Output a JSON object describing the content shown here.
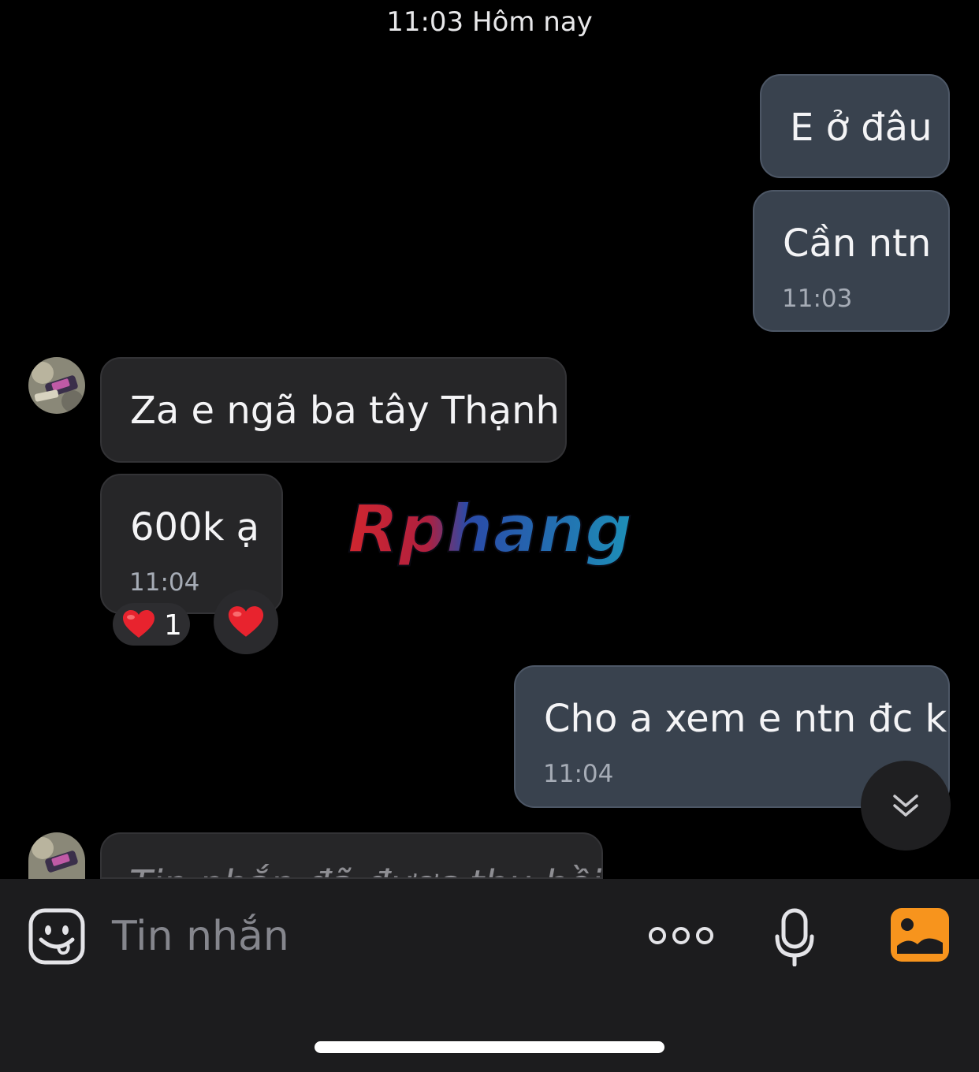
{
  "header": {
    "date_label": "11:03 Hôm nay"
  },
  "messages": [
    {
      "text": "E ở đâu"
    },
    {
      "text": "Cần ntn",
      "time": "11:03"
    },
    {
      "text": "Za e ngã ba tây Thạnh"
    },
    {
      "text": "600k ạ",
      "time": "11:04",
      "reaction_count": "1"
    },
    {
      "text": "Cho a xem e ntn đc k",
      "time": "11:04"
    },
    {
      "text": "Tin nhắn đã được thu hồi"
    }
  ],
  "watermark": {
    "text": "Rphang"
  },
  "composer": {
    "placeholder": "Tin nhắn"
  },
  "icons": {
    "sticker": "sticker-smile-icon",
    "more": "more-dots-icon",
    "mic": "microphone-icon",
    "photo": "photo-gallery-icon",
    "scroll_down": "double-chevron-down-icon",
    "reaction": "heart-icon"
  },
  "colors": {
    "outgoing_bubble": "#39424e",
    "incoming_bubble": "#262628",
    "accent_orange": "#f7941d",
    "background": "#000000"
  }
}
